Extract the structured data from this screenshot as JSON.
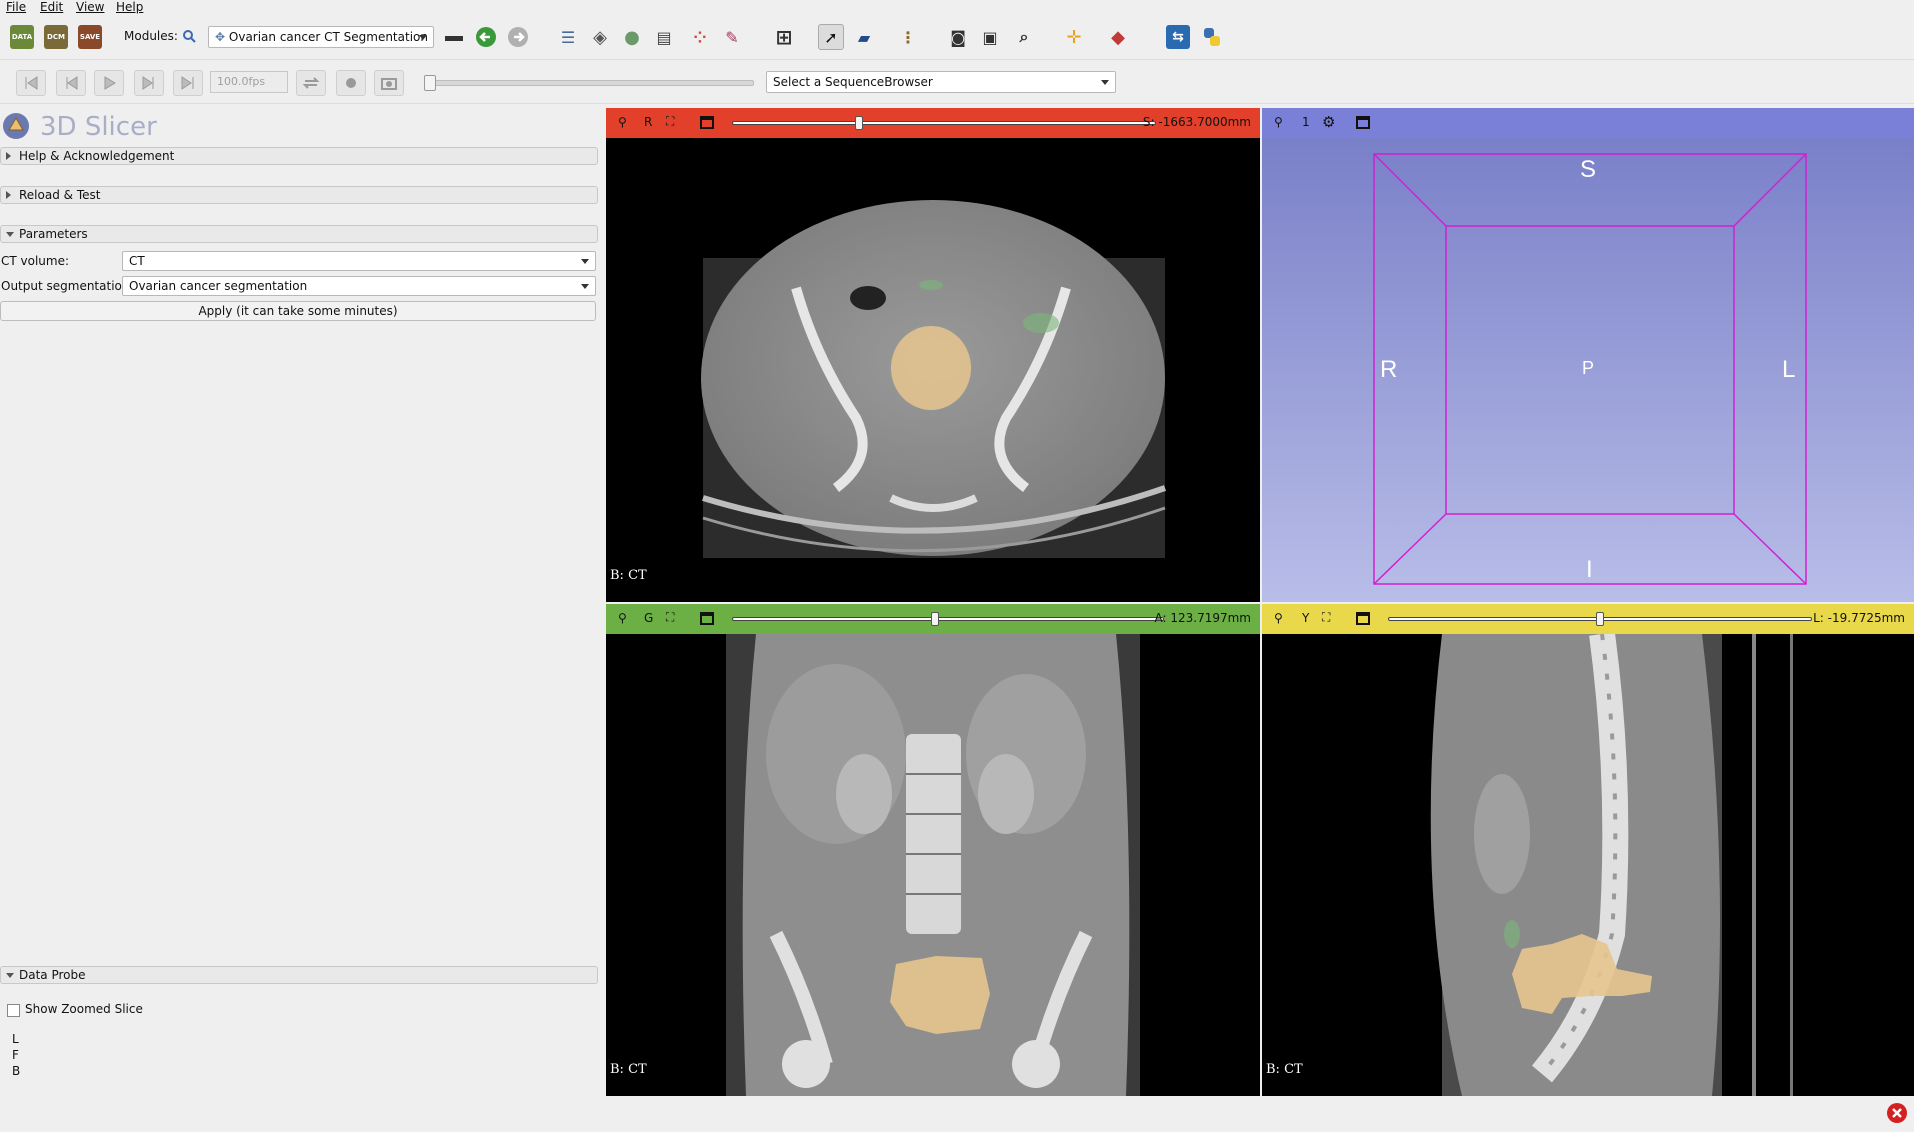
{
  "menus": [
    "File",
    "Edit",
    "View",
    "Help"
  ],
  "toolbar": {
    "data_label": "DATA",
    "dcm_label": "DCM",
    "save_label": "SAVE",
    "modules_label": "Modules:",
    "module_selected": "Ovarian cancer CT Segmentation"
  },
  "sequence": {
    "fps": "100.0fps",
    "browser_selector": "Select a SequenceBrowser"
  },
  "app": {
    "title": "3D Slicer"
  },
  "left_panel": {
    "sections": {
      "help": "Help & Acknowledgement",
      "reload": "Reload & Test",
      "parameters": "Parameters",
      "data_probe": "Data Probe"
    },
    "params": {
      "ct_volume_label": "CT volume:",
      "ct_volume_value": "CT",
      "output_seg_label": "Output segmentation:",
      "output_seg_value": "Ovarian cancer segmentation",
      "apply_button": "Apply (it can take some minutes)"
    },
    "data_probe": {
      "show_zoomed": "Show Zoomed Slice",
      "l": "L",
      "f": "F",
      "b": "B"
    }
  },
  "views": {
    "red": {
      "label": "R",
      "offset": "S: -1663.7000mm",
      "slider_fraction": 0.3,
      "caption": "B: CT",
      "color": "#e2402a"
    },
    "three_d": {
      "label": "1",
      "color": "#7a7fd8",
      "orient_s": "S",
      "orient_i": "I",
      "orient_r": "R",
      "orient_l": "L",
      "orient_p": "P"
    },
    "green": {
      "label": "G",
      "offset": "A: 123.7197mm",
      "slider_fraction": 0.47,
      "caption": "B: CT",
      "color": "#6cb045"
    },
    "yellow": {
      "label": "Y",
      "offset": "L: -19.7725mm",
      "slider_fraction": 0.5,
      "caption": "B: CT",
      "color": "#e8d84a"
    }
  }
}
